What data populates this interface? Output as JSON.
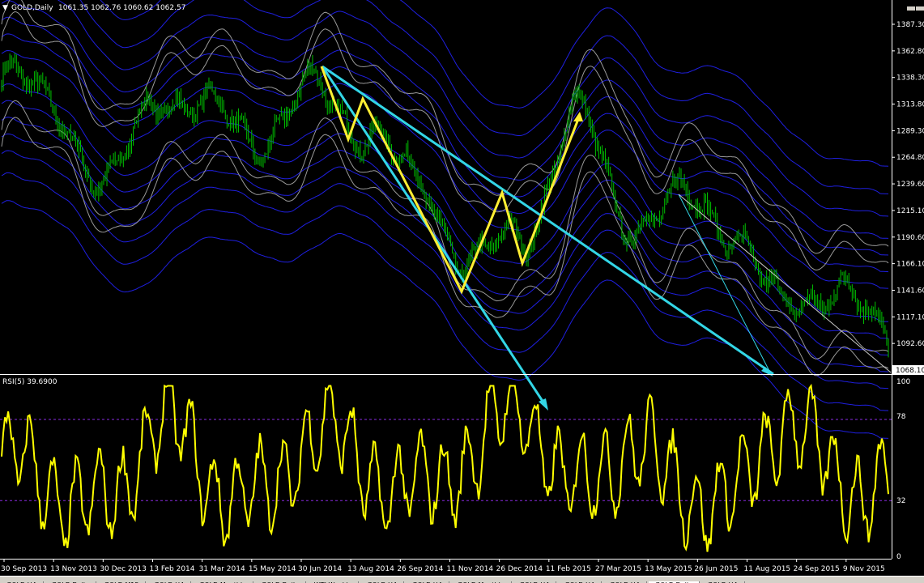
{
  "header": {
    "arrow": "▼",
    "label": "GOLD,Daily",
    "ohlc": "1061.35 1062.76 1060.62 1062.57"
  },
  "indicator": {
    "label": "RSI(5) 39.6900",
    "levels": [
      "100",
      "78",
      "32",
      "0"
    ]
  },
  "price_axis": [
    "1387.30",
    "1362.80",
    "1338.30",
    "1313.80",
    "1289.30",
    "1264.80",
    "1239.60",
    "1215.10",
    "1190.60",
    "1166.10",
    "1141.60",
    "1117.10",
    "1092.60",
    "1068.10"
  ],
  "current_price": "1068.10",
  "time_axis": [
    "30 Sep 2013",
    "13 Nov 2013",
    "30 Dec 2013",
    "13 Feb 2014",
    "31 Mar 2014",
    "15 May 2014",
    "30 Jun 2014",
    "13 Aug 2014",
    "26 Sep 2014",
    "11 Nov 2014",
    "26 Dec 2014",
    "11 Feb 2015",
    "27 Mar 2015",
    "13 May 2015",
    "26 Jun 2015",
    "11 Aug 2015",
    "24 Sep 2015",
    "9 Nov 2015"
  ],
  "tabs": [
    {
      "label": "GOLD,H4",
      "active": false
    },
    {
      "label": "GOLD,Daily",
      "active": false
    },
    {
      "label": "GOLD,M15",
      "active": false
    },
    {
      "label": "GOLD,H4",
      "active": false
    },
    {
      "label": "GOLD,Monthly",
      "active": false
    },
    {
      "label": "GOLD,Daily",
      "active": false
    },
    {
      "label": "WTI,Weekly",
      "active": false
    },
    {
      "label": "GOLD,H4",
      "active": false
    },
    {
      "label": "GOLD,H4",
      "active": false
    },
    {
      "label": "GOLD,Monthly",
      "active": false
    },
    {
      "label": "GOLD,H4",
      "active": false
    },
    {
      "label": "GOLD,H4",
      "active": false
    },
    {
      "label": "GOLD,H4",
      "active": false
    },
    {
      "label": "GOLD,Daily",
      "active": true
    },
    {
      "label": "GOLD,H4",
      "active": false
    }
  ],
  "colors": {
    "background": "#000000",
    "candles": "#00c000",
    "envelope_blue": "#1f1fe0",
    "bollinger_gray": "#9a9a9a",
    "rsi": "#ffff00",
    "trendline": "#33d6e6",
    "pattern": "#ffee33",
    "level_line": "#8a2be2"
  },
  "chart_data": [
    {
      "type": "line",
      "title": "GOLD,Daily",
      "ylim": [
        1068.1,
        1387.3
      ],
      "x": [
        "30 Sep 2013",
        "13 Nov 2013",
        "30 Dec 2013",
        "13 Feb 2014",
        "31 Mar 2014",
        "15 May 2014",
        "30 Jun 2014",
        "13 Aug 2014",
        "26 Sep 2014",
        "11 Nov 2014",
        "26 Dec 2014",
        "11 Feb 2015",
        "27 Mar 2015",
        "13 May 2015",
        "26 Jun 2015",
        "11 Aug 2015",
        "24 Sep 2015",
        "9 Nov 2015"
      ],
      "series": [
        {
          "values": [
            1330,
            1310,
            1230,
            1320,
            1300,
            1280,
            1320,
            1285,
            1235,
            1165,
            1190,
            1300,
            1205,
            1220,
            1200,
            1120,
            1150,
            1090
          ]
        }
      ]
    },
    {
      "type": "line",
      "title": "RSI(5) 39.6900",
      "ylim": [
        0,
        100
      ],
      "x": [
        "30 Sep 2013",
        "13 Nov 2013",
        "30 Dec 2013",
        "13 Feb 2014",
        "31 Mar 2014",
        "15 May 2014",
        "30 Jun 2014",
        "13 Aug 2014",
        "26 Sep 2014",
        "11 Nov 2014",
        "26 Dec 2014",
        "11 Feb 2015",
        "27 Mar 2015",
        "13 May 2015",
        "26 Jun 2015",
        "11 Aug 2015",
        "24 Sep 2015",
        "9 Nov 2015"
      ],
      "series": [
        {
          "values": [
            55,
            40,
            25,
            80,
            45,
            30,
            75,
            50,
            35,
            60,
            85,
            35,
            65,
            40,
            30,
            80,
            45,
            40
          ]
        }
      ]
    }
  ]
}
